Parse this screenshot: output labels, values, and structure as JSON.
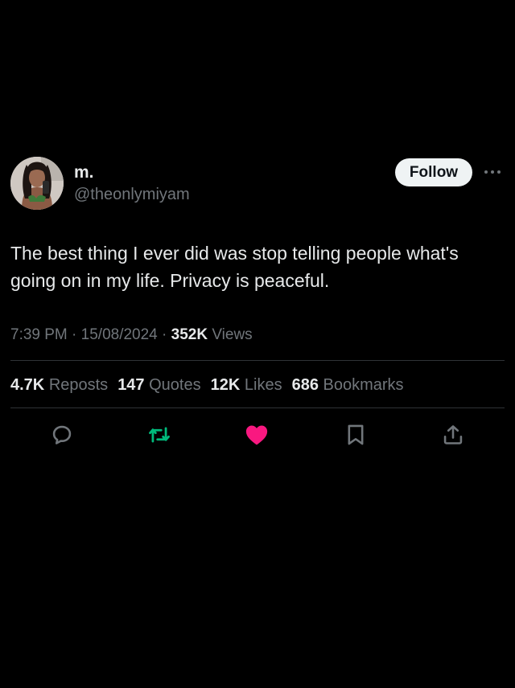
{
  "user": {
    "display_name": "m.",
    "handle": "@theonlymiyam",
    "avatar_icon": "profile-photo"
  },
  "follow_label": "Follow",
  "tweet": {
    "text": "The best thing I ever did was stop telling people what's going on in my life. Privacy is peaceful.",
    "time": "7:39 PM",
    "date": "15/08/2024",
    "views_count": "352K",
    "views_label": "Views"
  },
  "stats": {
    "reposts_count": "4.7K",
    "reposts_label": "Reposts",
    "quotes_count": "147",
    "quotes_label": "Quotes",
    "likes_count": "12K",
    "likes_label": "Likes",
    "bookmarks_count": "686",
    "bookmarks_label": "Bookmarks"
  },
  "actions": {
    "reply_icon": "reply-icon",
    "repost_icon": "repost-icon",
    "like_icon": "heart-icon",
    "bookmark_icon": "bookmark-icon",
    "share_icon": "share-icon"
  },
  "colors": {
    "background": "#000000",
    "primary_text": "#e7e9ea",
    "secondary_text": "#71767b",
    "repost_active": "#00ba7c",
    "like_active": "#f91880",
    "divider": "#2f3336"
  }
}
